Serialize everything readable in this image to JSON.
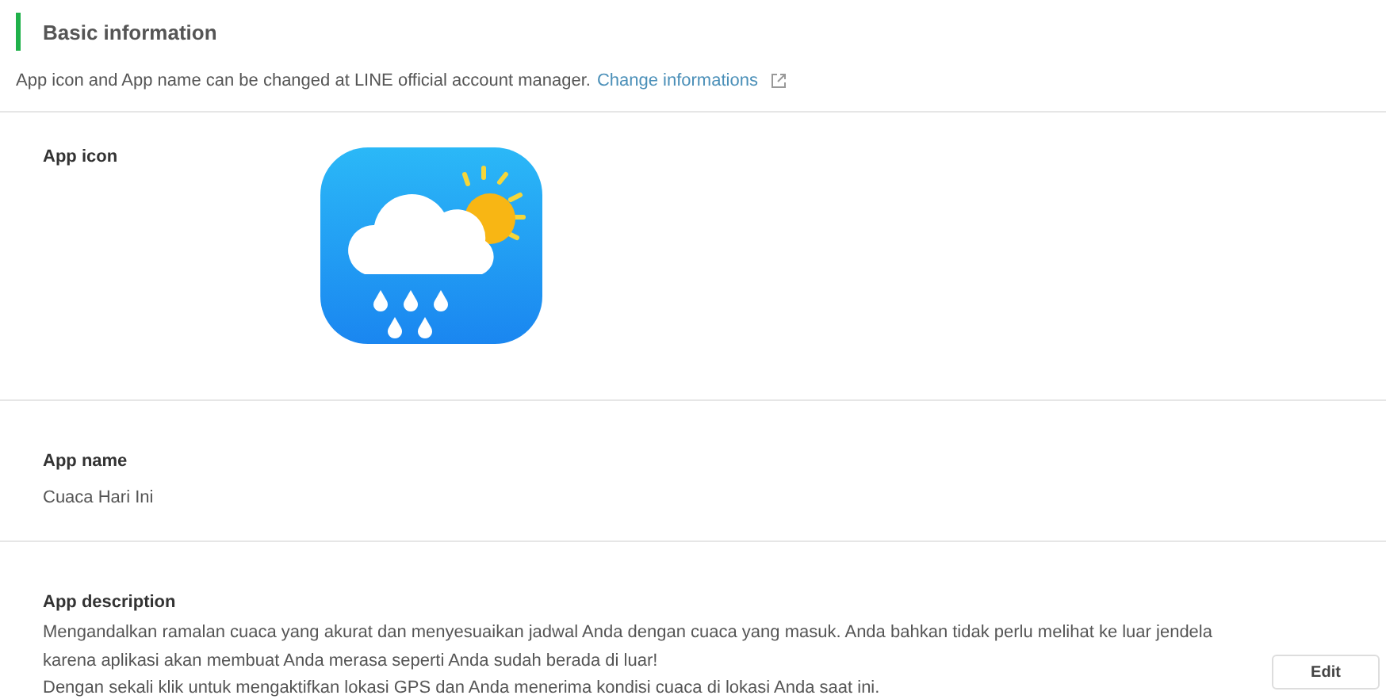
{
  "section": {
    "title": "Basic information",
    "note": "App icon and App name can be changed at LINE official account manager.",
    "link": "Change informations"
  },
  "fields": [
    {
      "kind": "icon",
      "label": "App icon"
    },
    {
      "kind": "text",
      "label": "App name",
      "value": "Cuaca Hari Ini"
    },
    {
      "kind": "paragraphs",
      "label": "App description",
      "paragraphs": [
        "Mengandalkan ramalan cuaca yang akurat dan menyesuaikan jadwal Anda dengan cuaca yang masuk. Anda bahkan tidak perlu melihat ke luar jendela karena aplikasi akan membuat Anda merasa seperti Anda sudah berada di luar!",
        "Dengan sekali klik untuk mengaktifkan lokasi GPS dan Anda menerima kondisi cuaca di lokasi Anda saat ini."
      ],
      "button": "Edit"
    }
  ]
}
